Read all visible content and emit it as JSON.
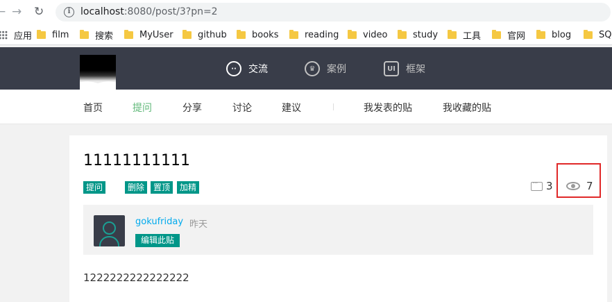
{
  "browser": {
    "url_host": "localhost",
    "url_rest": ":8080/post/3?pn=2",
    "bookmarks": [
      "应用",
      "film",
      "搜索",
      "MyUser",
      "github",
      "books",
      "reading",
      "video",
      "study",
      "工具",
      "官网",
      "blog",
      "SQL"
    ]
  },
  "header": {
    "nav": [
      {
        "label": "交流",
        "icon": "chat-bubble-icon"
      },
      {
        "label": "案例",
        "icon": "crown-icon"
      },
      {
        "label": "框架",
        "icon": "ui-logo-icon"
      }
    ]
  },
  "subnav": {
    "items": [
      "首页",
      "提问",
      "分享",
      "讨论",
      "建议"
    ],
    "active": "提问",
    "user_items": [
      "我发表的贴",
      "我收藏的贴"
    ]
  },
  "post": {
    "title": "11111111111",
    "category": "提问",
    "actions": [
      "删除",
      "置顶",
      "加精"
    ],
    "comment_count": "3",
    "view_count": "7",
    "author": "gokufriday",
    "time": "昨天",
    "edit_label": "编辑此贴",
    "content": "1222222222222222"
  },
  "colors": {
    "header_bg": "#393d49",
    "badge": "#009688",
    "active_nav": "#5fb878",
    "username": "#01aaed",
    "highlight": "#e02828"
  }
}
